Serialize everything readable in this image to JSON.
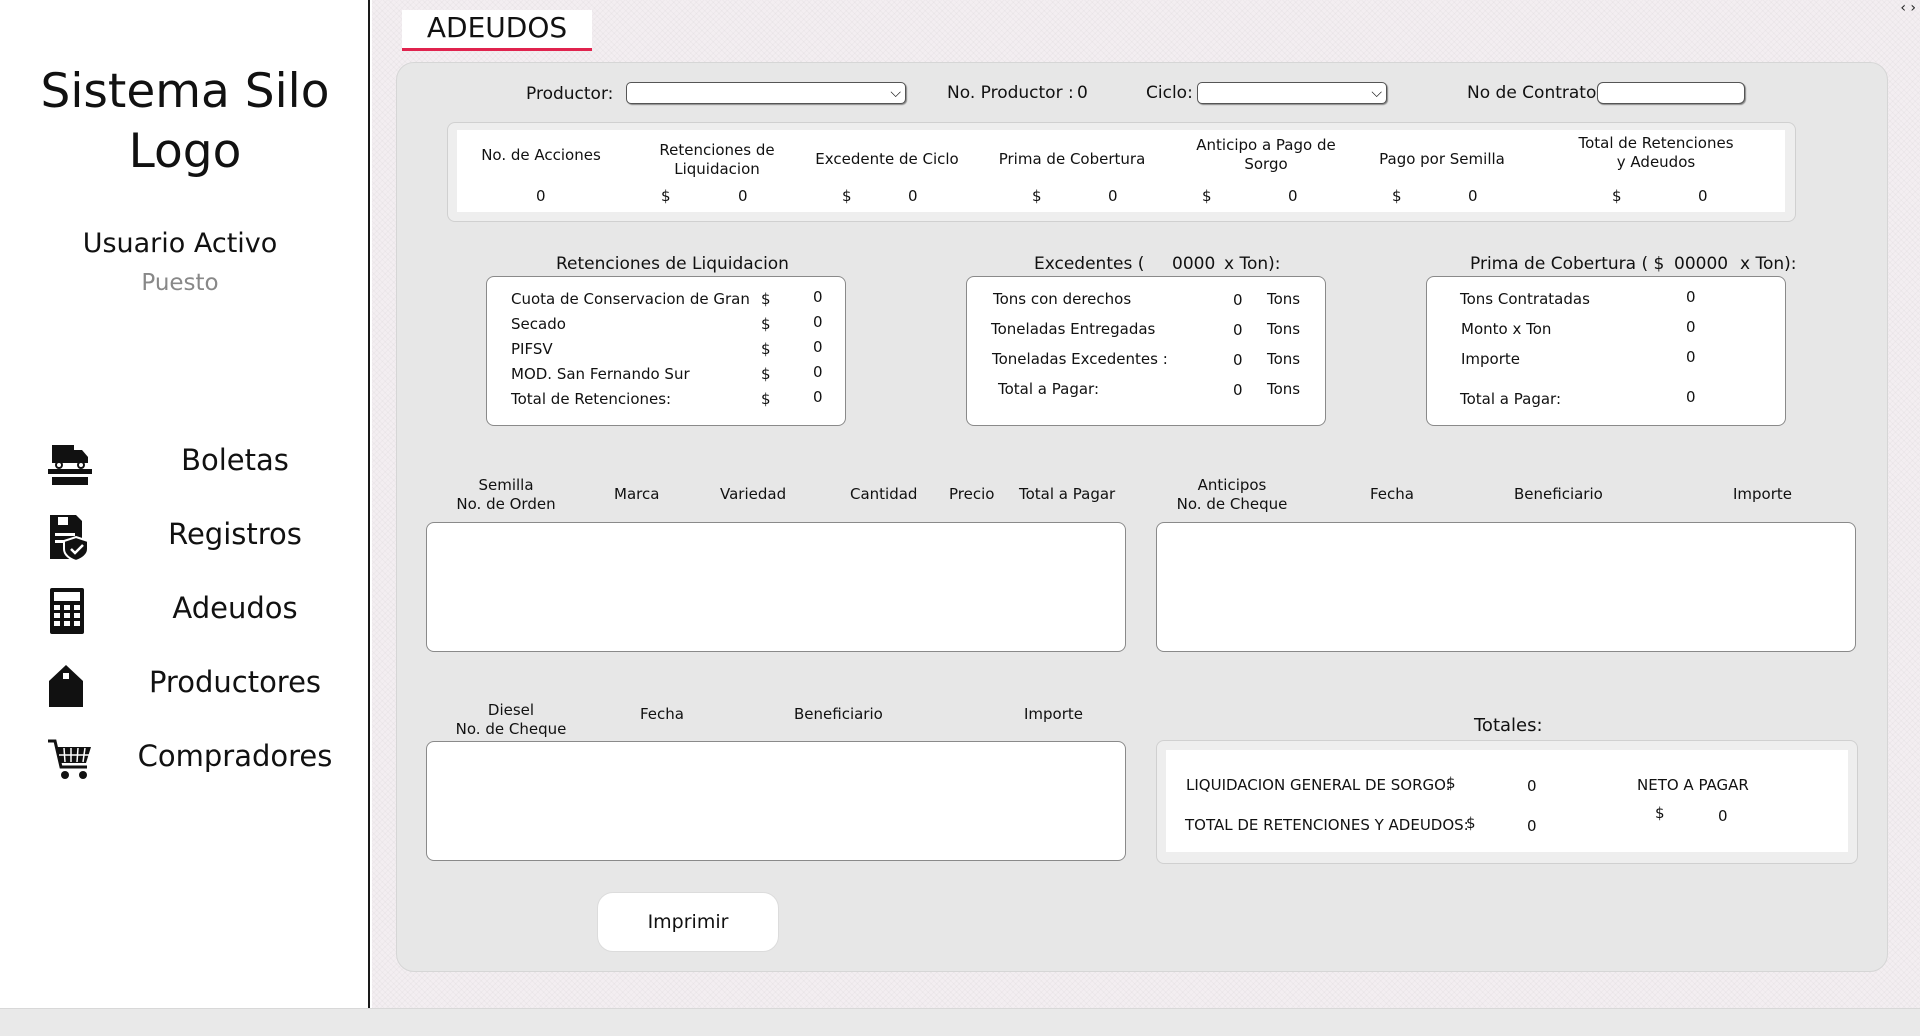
{
  "sidebar": {
    "title_line1": "Sistema Silo",
    "title_line2": "Logo",
    "user": "Usuario Activo",
    "role": "Puesto",
    "nav": [
      {
        "label": "Boletas",
        "icon": "truck-scale-icon"
      },
      {
        "label": "Registros",
        "icon": "document-shield-icon"
      },
      {
        "label": "Adeudos",
        "icon": "calculator-icon"
      },
      {
        "label": "Productores",
        "icon": "house-icon"
      },
      {
        "label": "Compradores",
        "icon": "shopping-cart-icon"
      }
    ]
  },
  "tab": {
    "title": "ADEUDOS"
  },
  "filters": {
    "productor_label": "Productor:",
    "productor_value": "",
    "no_productor_label": "No. Productor :",
    "no_productor_value": "0",
    "ciclo_label": "Ciclo:",
    "ciclo_value": "",
    "contrato_label": "No de Contrato:",
    "contrato_value": ""
  },
  "summary": {
    "columns": [
      {
        "label": "No. de Acciones",
        "currency": "",
        "value": "0"
      },
      {
        "label": "Retenciones de Liquidacion",
        "currency": "$",
        "value": "0"
      },
      {
        "label": "Excedente de Ciclo",
        "currency": "$",
        "value": "0"
      },
      {
        "label": "Prima de Cobertura",
        "currency": "$",
        "value": "0"
      },
      {
        "label": "Anticipo a Pago de Sorgo",
        "currency": "$",
        "value": "0"
      },
      {
        "label": "Pago por Semilla",
        "currency": "$",
        "value": "0"
      },
      {
        "label": "Total de Retenciones y Adeudos",
        "currency": "$",
        "value": "0"
      }
    ]
  },
  "retenciones": {
    "title": "Retenciones de Liquidacion",
    "rows": [
      {
        "label": "Cuota de Conservacion de Gran",
        "currency": "$",
        "value": "0"
      },
      {
        "label": "Secado",
        "currency": "$",
        "value": "0"
      },
      {
        "label": "PIFSV",
        "currency": "$",
        "value": "0"
      },
      {
        "label": "MOD. San Fernando Sur",
        "currency": "$",
        "value": "0"
      },
      {
        "label": "Total de Retenciones:",
        "currency": "$",
        "value": "0"
      }
    ]
  },
  "excedentes": {
    "title_prefix": "Excedentes (",
    "rate": "0000",
    "title_suffix": "x Ton):",
    "rows": [
      {
        "label": "Tons con derechos",
        "value": "0",
        "unit": "Tons"
      },
      {
        "label": "Toneladas Entregadas",
        "value": "0",
        "unit": "Tons"
      },
      {
        "label": "Toneladas Excedentes :",
        "value": "0",
        "unit": "Tons"
      },
      {
        "label": "Total a Pagar:",
        "value": "0",
        "unit": "Tons"
      }
    ]
  },
  "prima": {
    "title_prefix": "Prima de Cobertura ( $",
    "rate": "00000",
    "title_suffix": "x Ton):",
    "rows": [
      {
        "label": "Tons Contratadas",
        "value": "0"
      },
      {
        "label": "Monto x Ton",
        "value": "0"
      },
      {
        "label": "Importe",
        "value": "0"
      },
      {
        "label": "Total a Pagar:",
        "value": "0"
      }
    ]
  },
  "semilla_table": {
    "headers": [
      "Semilla\nNo. de Orden",
      "Marca",
      "Variedad",
      "Cantidad",
      "Precio",
      "Total a Pagar"
    ],
    "rows": []
  },
  "anticipos_table": {
    "headers": [
      "Anticipos\nNo. de Cheque",
      "Fecha",
      "Beneficiario",
      "Importe"
    ],
    "rows": []
  },
  "diesel_table": {
    "headers": [
      "Diesel\nNo. de Cheque",
      "Fecha",
      "Beneficiario",
      "Importe"
    ],
    "rows": []
  },
  "totales": {
    "title": "Totales:",
    "liquidacion_label": "LIQUIDACION GENERAL DE SORGO:",
    "liquidacion_currency": "$",
    "liquidacion_value": "0",
    "retenciones_label": "TOTAL DE RETENCIONES Y ADEUDOS:",
    "retenciones_currency": "$",
    "retenciones_value": "0",
    "neto_label": "NETO A PAGAR",
    "neto_currency": "$",
    "neto_value": "0"
  },
  "actions": {
    "print_label": "Imprimir"
  },
  "window_corner": "‹ ›"
}
